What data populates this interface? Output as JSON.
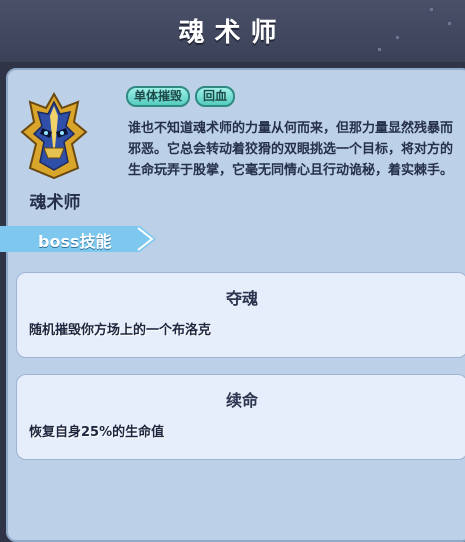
{
  "header": {
    "title": "魂术师"
  },
  "character": {
    "name": "魂术师",
    "icon": "golden-masked-knight-helmet-icon",
    "tags": [
      "单体摧毁",
      "回血"
    ],
    "description": "谁也不知道魂术师的力量从何而来，但那力量显然残暴而邪恶。它总会转动着狡猾的双眼挑选一个目标，将对方的生命玩弄于股掌，它毫无同情心且行动诡秘，着实棘手。"
  },
  "skills_section": {
    "label": "boss技能"
  },
  "skills": [
    {
      "name": "夺魂",
      "description": "随机摧毁你方场上的一个布洛克"
    },
    {
      "name": "续命",
      "description": "恢复自身25%的生命值"
    }
  ],
  "colors": {
    "tag_fill": "#56cdbf",
    "panel": "#bcd0e8",
    "card": "#e7eefb",
    "section_tab": "#7ec8f0"
  }
}
